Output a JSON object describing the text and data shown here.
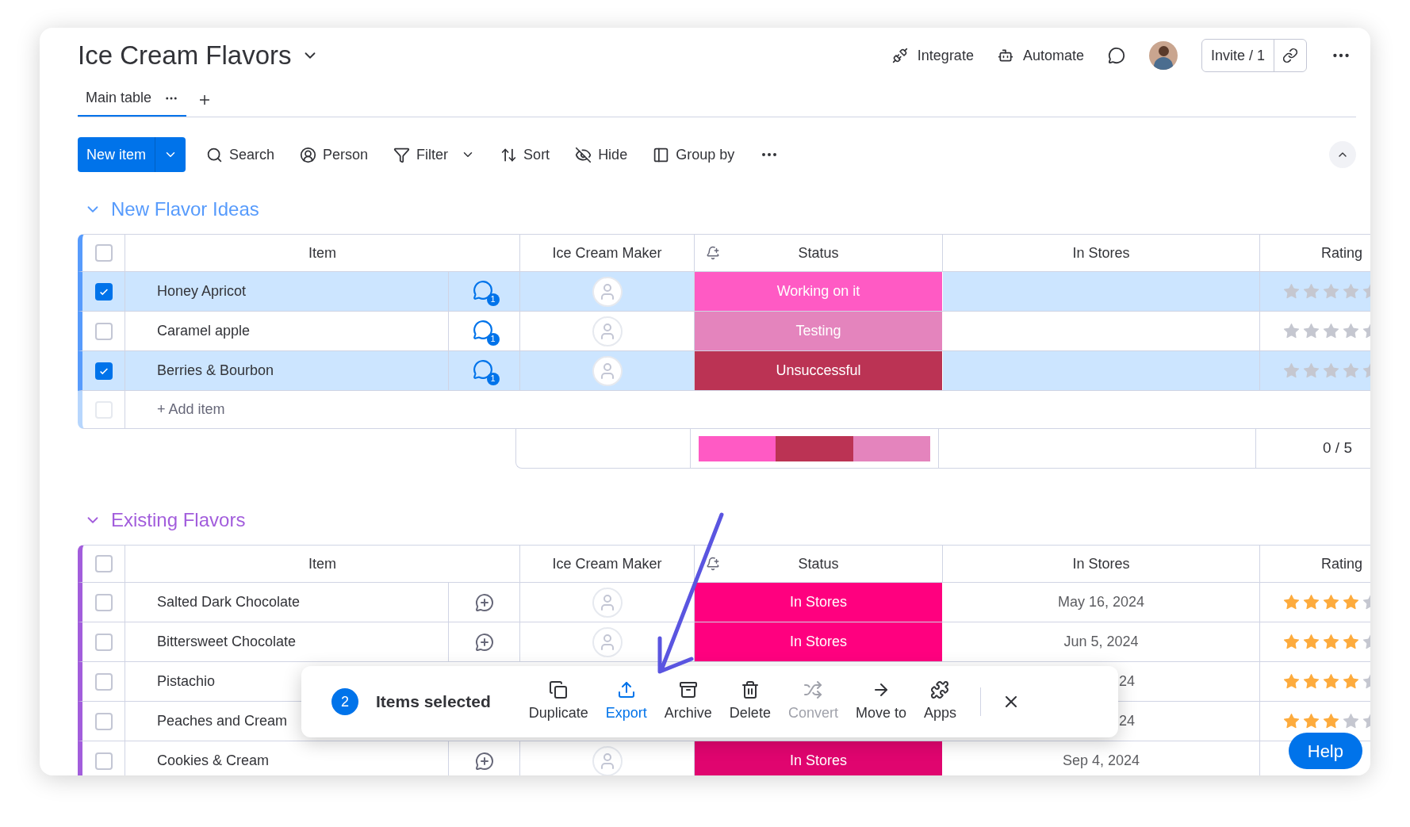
{
  "board": {
    "title": "Ice Cream Flavors"
  },
  "header_actions": [
    {
      "label": "Integrate",
      "kind": "integrate"
    },
    {
      "label": "Automate",
      "kind": "automate"
    }
  ],
  "invite": {
    "label": "Invite / 1"
  },
  "tabs": [
    {
      "label": "Main table",
      "selected": true
    }
  ],
  "toolbar": {
    "new_item": "New item",
    "tools": [
      {
        "label": "Search",
        "kind": "search"
      },
      {
        "label": "Person",
        "kind": "person"
      },
      {
        "label": "Filter",
        "kind": "filter"
      },
      {
        "label": "Sort",
        "kind": "sort"
      },
      {
        "label": "Hide",
        "kind": "hide"
      },
      {
        "label": "Group by",
        "kind": "group"
      }
    ]
  },
  "groups": [
    {
      "title": "New Flavor Ideas",
      "color": "#579bfc",
      "select_all": false,
      "add_row_checked": false,
      "columns": [
        "Item",
        "Ice Cream Maker",
        "Status",
        "In Stores",
        "Rating"
      ],
      "rows": [
        {
          "item": "Honey Apricot",
          "checked": true,
          "comments": "1",
          "status": "Working on it",
          "color": "#ff5ac4",
          "in_stores": "",
          "stars": 0
        },
        {
          "item": "Caramel apple",
          "checked": false,
          "comments": "1",
          "status": "Testing",
          "color": "#e484bd",
          "in_stores": "",
          "stars": 0
        },
        {
          "item": "Berries & Bourbon",
          "checked": true,
          "comments": "1",
          "status": "Unsuccessful",
          "color": "#bb3354",
          "in_stores": "",
          "stars": 0
        }
      ],
      "add_item": "+ Add item",
      "summary": {
        "segments": [
          {
            "color": "#ff5ac4"
          },
          {
            "color": "#bb3354"
          },
          {
            "color": "#e484bd"
          }
        ],
        "rating": "0 / 5"
      }
    },
    {
      "title": "Existing Flavors",
      "color": "#a25ddc",
      "select_all": false,
      "columns": [
        "Item",
        "Ice Cream Maker",
        "Status",
        "In Stores",
        "Rating"
      ],
      "rows": [
        {
          "item": "Salted Dark Chocolate",
          "checked": false,
          "status": "In Stores",
          "color": "#ff007f",
          "in_stores": "May 16, 2024",
          "stars": 4
        },
        {
          "item": "Bittersweet Chocolate",
          "checked": false,
          "status": "In Stores",
          "color": "#ff007f",
          "in_stores": "Jun 5, 2024",
          "stars": 4
        },
        {
          "item": "Pistachio",
          "checked": false,
          "kind": "covered",
          "in_stores": "24",
          "stars": 4
        },
        {
          "item": "Peaches and Cream",
          "checked": false,
          "kind": "covered",
          "in_stores": "24",
          "stars": 3
        },
        {
          "item": "Cookies & Cream",
          "checked": false,
          "status": "In Stores",
          "color": "#e0056f",
          "in_stores": "Sep 4, 2024"
        }
      ]
    }
  ],
  "selection_bar": {
    "count": "2",
    "label": "Items selected",
    "actions": [
      {
        "label": "Duplicate",
        "kind": "duplicate",
        "selected": false,
        "disabled": false
      },
      {
        "label": "Export",
        "kind": "export",
        "selected": true,
        "disabled": false
      },
      {
        "label": "Archive",
        "kind": "archive",
        "selected": false,
        "disabled": false
      },
      {
        "label": "Delete",
        "kind": "delete",
        "selected": false,
        "disabled": false
      },
      {
        "label": "Convert",
        "kind": "convert",
        "selected": false,
        "disabled": true
      },
      {
        "label": "Move to",
        "kind": "move",
        "selected": false,
        "disabled": false
      },
      {
        "label": "Apps",
        "kind": "apps",
        "selected": false,
        "disabled": false
      }
    ]
  },
  "help": {
    "label": "Help"
  }
}
